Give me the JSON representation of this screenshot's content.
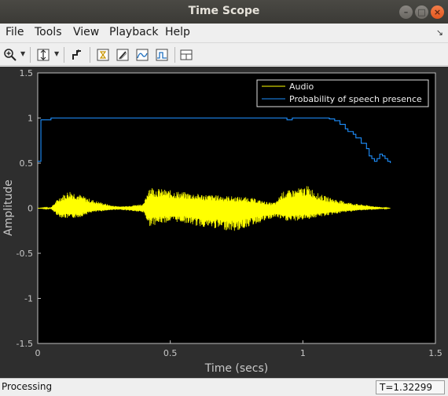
{
  "window": {
    "title": "Time Scope",
    "controls": {
      "minimize": "–",
      "maximize": "□",
      "close": "×"
    }
  },
  "menu": {
    "items": [
      {
        "label": "File"
      },
      {
        "label": "Tools"
      },
      {
        "label": "View"
      },
      {
        "label": "Playback"
      },
      {
        "label": "Help"
      }
    ]
  },
  "toolbar": {
    "buttons": [
      "zoom-in-icon",
      "autoscale-icon",
      "step-icon",
      "trigger-icon",
      "cursor-icon",
      "peak-icon",
      "bilevel-icon",
      "layout-icon"
    ]
  },
  "plot": {
    "background": "#000000",
    "axes_color": "#c0c0c0",
    "xlabel": "Time (secs)",
    "ylabel": "Amplitude",
    "xticks": [
      "0",
      "0.5",
      "1",
      "1.5"
    ],
    "yticks": [
      "1.5",
      "1",
      "0.5",
      "0",
      "-0.5",
      "-1",
      "-1.5"
    ],
    "legend": {
      "placement": "top-right",
      "entries": [
        {
          "label": "Audio",
          "color": "#ffff00"
        },
        {
          "label": "Probability of speech presence",
          "color": "#1e90ff"
        }
      ]
    }
  },
  "chart_data": {
    "type": "line",
    "xlim": [
      0,
      1.5
    ],
    "ylim": [
      -1.5,
      1.5
    ],
    "grid": false,
    "series": [
      {
        "name": "Audio",
        "color": "#ffff00",
        "envelope": {
          "x": [
            0.0,
            0.05,
            0.08,
            0.12,
            0.16,
            0.2,
            0.28,
            0.32,
            0.4,
            0.42,
            0.45,
            0.5,
            0.55,
            0.6,
            0.7,
            0.75,
            0.8,
            0.85,
            0.88,
            0.9,
            0.92,
            0.95,
            0.98,
            1.02,
            1.06,
            1.1,
            1.15,
            1.2,
            1.25,
            1.3,
            1.33
          ],
          "upper": [
            0.0,
            0.01,
            0.12,
            0.2,
            0.15,
            0.1,
            0.03,
            0.02,
            0.05,
            0.25,
            0.22,
            0.2,
            0.18,
            0.16,
            0.14,
            0.13,
            0.12,
            0.08,
            0.06,
            0.07,
            0.18,
            0.2,
            0.22,
            0.25,
            0.16,
            0.12,
            0.08,
            0.05,
            0.03,
            0.01,
            0.0
          ],
          "lower": [
            0.0,
            -0.01,
            -0.1,
            -0.12,
            -0.1,
            -0.05,
            -0.02,
            -0.02,
            -0.05,
            -0.2,
            -0.18,
            -0.15,
            -0.16,
            -0.2,
            -0.24,
            -0.26,
            -0.2,
            -0.15,
            -0.12,
            -0.1,
            -0.13,
            -0.15,
            -0.14,
            -0.12,
            -0.1,
            -0.08,
            -0.05,
            -0.03,
            -0.02,
            -0.01,
            0.0
          ]
        }
      },
      {
        "name": "Probability of speech presence",
        "color": "#1e90ff",
        "x": [
          0.0,
          0.01,
          0.012,
          0.05,
          0.3,
          0.6,
          0.9,
          0.92,
          0.94,
          0.96,
          1.0,
          1.06,
          1.1,
          1.12,
          1.14,
          1.16,
          1.17,
          1.19,
          1.2,
          1.22,
          1.24,
          1.25,
          1.26,
          1.27,
          1.28,
          1.29,
          1.3,
          1.31,
          1.32,
          1.33
        ],
        "y": [
          0.52,
          0.52,
          0.98,
          1.0,
          1.0,
          1.0,
          1.0,
          1.0,
          0.98,
          1.0,
          1.0,
          1.0,
          0.99,
          0.97,
          0.93,
          0.88,
          0.85,
          0.82,
          0.78,
          0.72,
          0.66,
          0.58,
          0.55,
          0.52,
          0.55,
          0.6,
          0.58,
          0.55,
          0.52,
          0.5
        ]
      }
    ]
  },
  "status": {
    "message": "Processing",
    "time": "T=1.32299"
  }
}
